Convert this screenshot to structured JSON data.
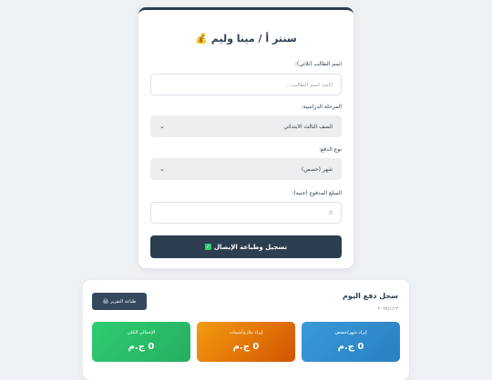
{
  "form": {
    "title_icon": "money-bag-icon",
    "title": "سنتر أ / مينا وليم",
    "student_name_label": "اسم الطالب (ثلاثي):",
    "student_name_placeholder": "اكتب اسم الطالب...",
    "stage_label": "المرحلة الدراسية:",
    "stage_value": "الصف الثالث الابتدائي",
    "payment_type_label": "نوع الدفع:",
    "payment_type_value": "شهر (حصص)",
    "amount_label": "المبلغ المدفوع (جنيه):",
    "amount_value": "0",
    "submit_label": "تسجيل وطباعة الإيصال"
  },
  "daily": {
    "title": "سجل دفع اليوم",
    "date": "٢٠٢٥/١/١٣",
    "print_label": "طباعة التقرير",
    "stats": [
      {
        "label": "إيراد شهر/حصص",
        "value": "0 ج.م",
        "color": "#3a9ad9"
      },
      {
        "label": "إيراد ملازم/شيتات",
        "value": "0 ج.م",
        "color": "#e67e22"
      },
      {
        "label": "الإجمالي الكلي",
        "value": "0 ج.م",
        "color": "#2ecc71"
      }
    ]
  }
}
